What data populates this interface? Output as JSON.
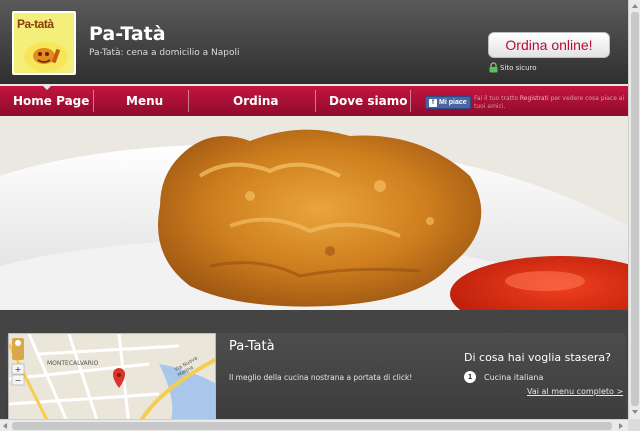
{
  "header": {
    "logo_text": "Pa-tatà",
    "title": "Pa-Tatà",
    "subtitle": "Pa-Tatà: cena a domicilio a Napoli",
    "order_button": "Ordina online!",
    "secure_label": "Sito sicuro"
  },
  "nav": {
    "items": [
      {
        "label": "Home Page"
      },
      {
        "label": "Menu"
      },
      {
        "label": "Ordina"
      },
      {
        "label": "Dove siamo"
      }
    ],
    "like_button": "Mi piace",
    "like_text_pre": "Fai il tuo tratto ",
    "like_link": "Registrati",
    "like_text_post": " per vedere cosa piace ai tuoi amici."
  },
  "map": {
    "place_label": "MONTECALVARIO",
    "street_label": "Via Nuova Marina"
  },
  "info": {
    "title": "Pa-Tatà",
    "description": "Il meglio della cucina nostrana a portata di click!"
  },
  "craving": {
    "title": "Di cosa hai voglia stasera?",
    "items": [
      {
        "num": "1",
        "label": "Cucina italiana"
      }
    ],
    "menu_link": "Vai al menu completo >"
  },
  "colors": {
    "nav_red": "#b01035",
    "header_dark": "#3a3a3a",
    "order_text": "#b80f3a"
  }
}
